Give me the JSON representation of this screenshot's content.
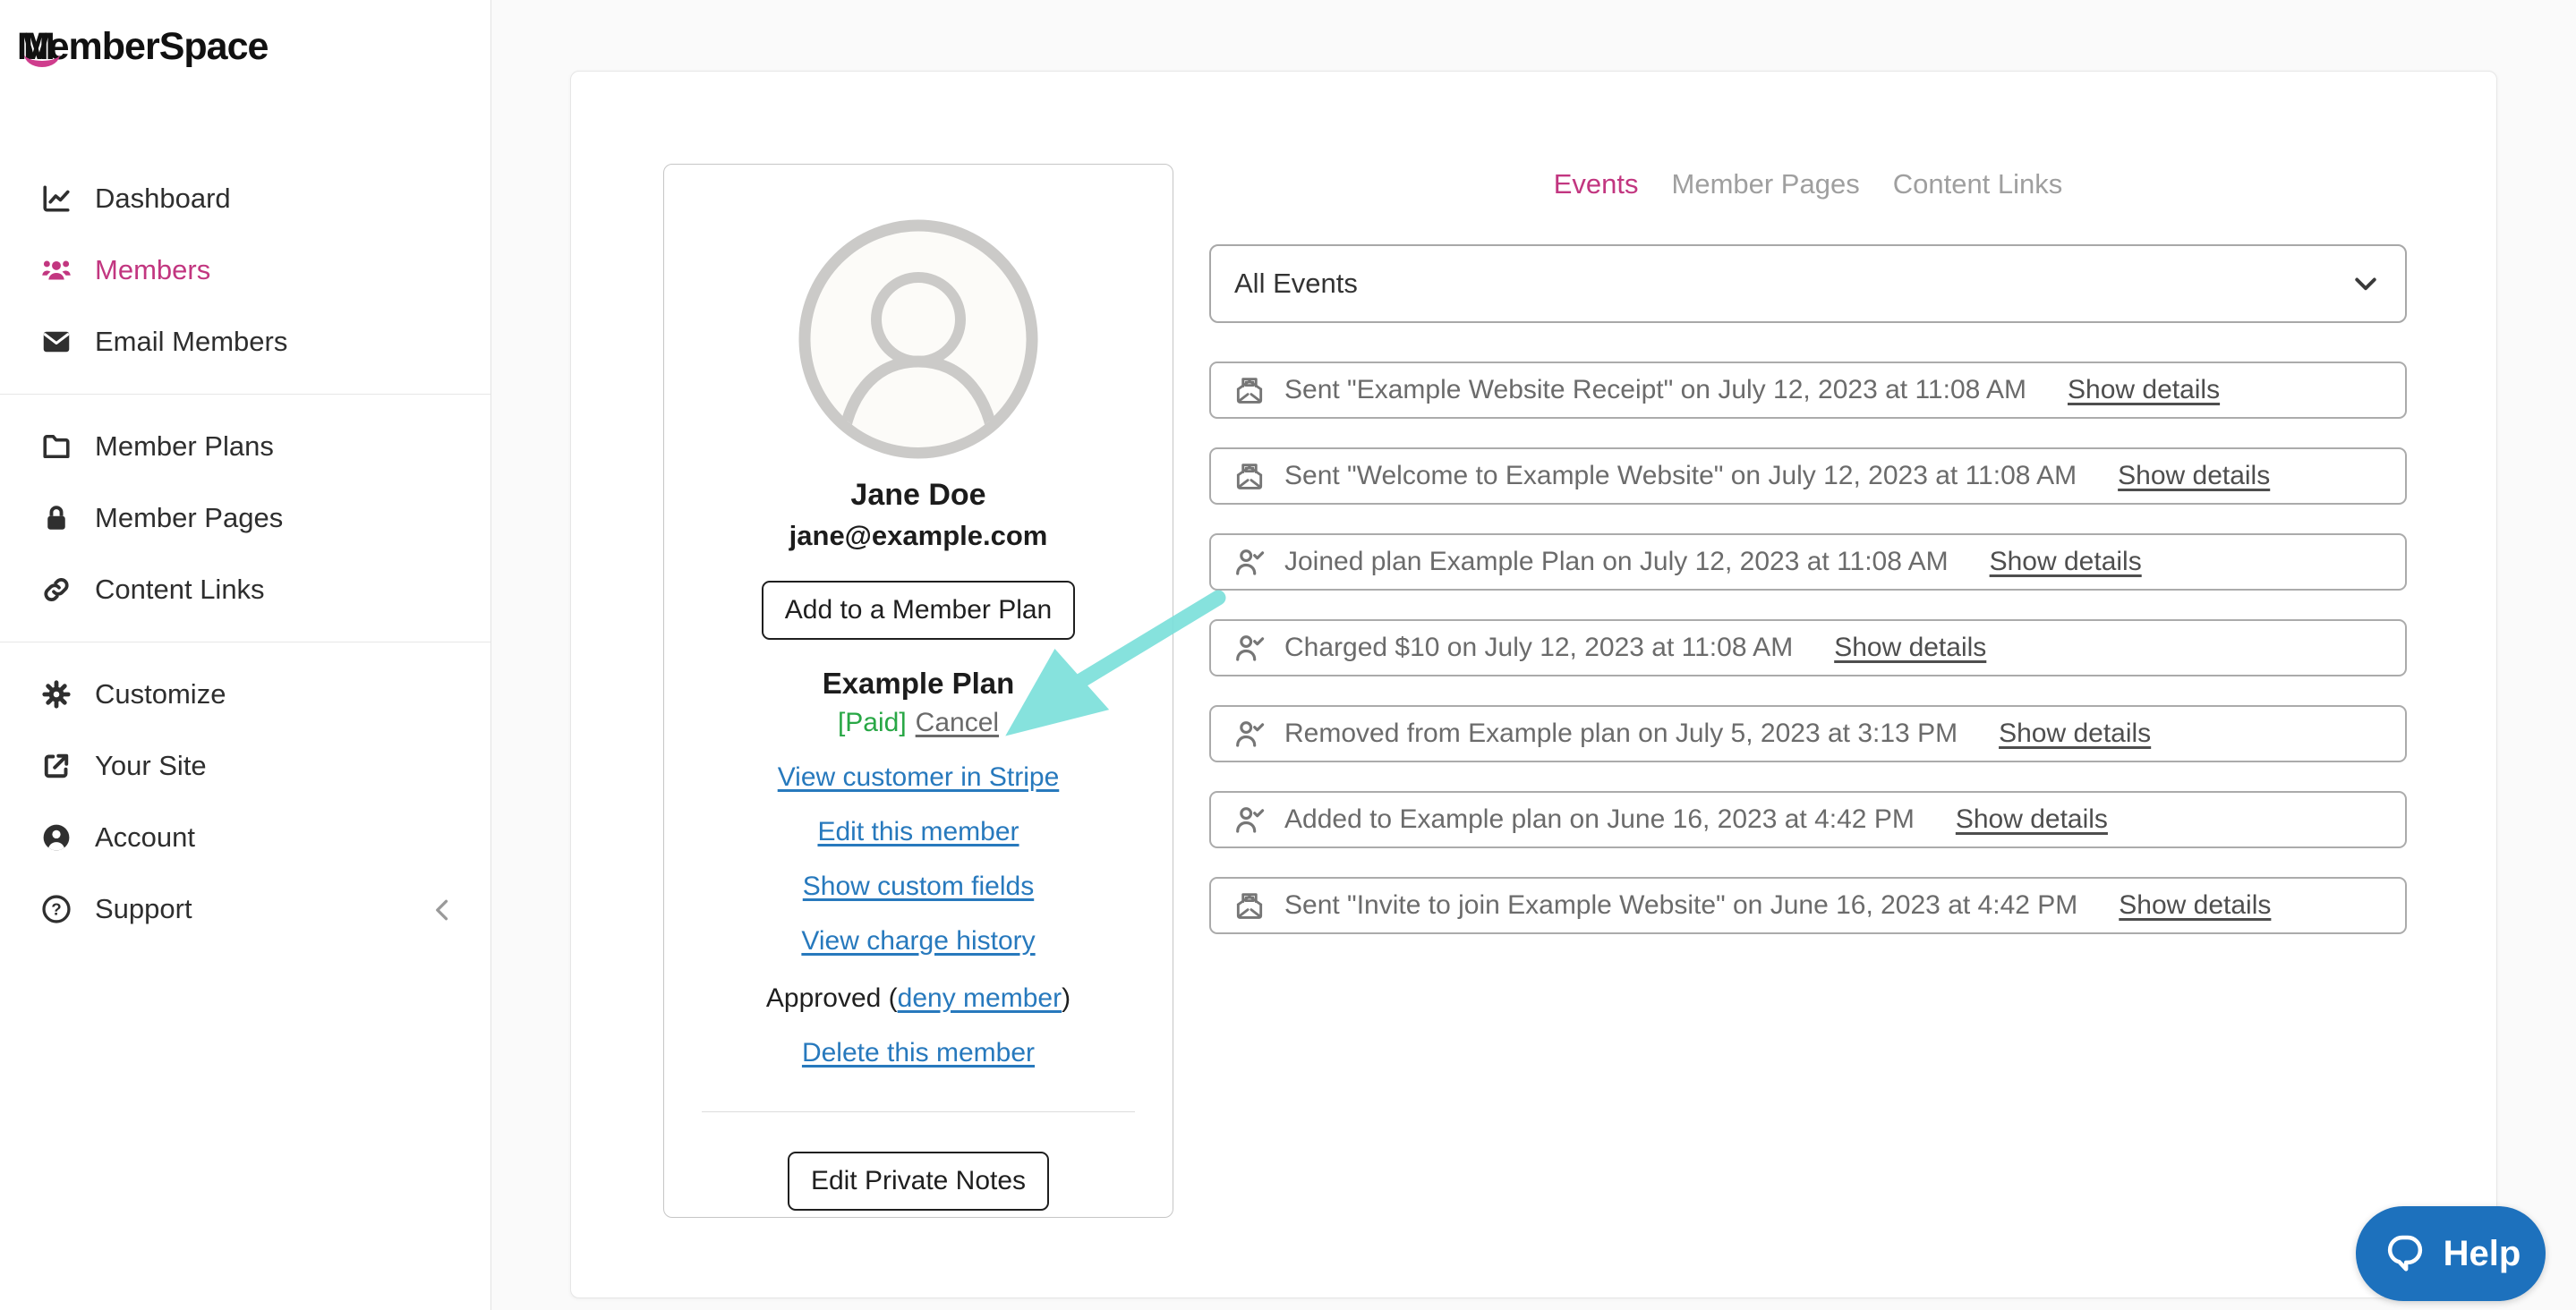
{
  "brand": {
    "name": "MemberSpace"
  },
  "sidebar": {
    "items": [
      {
        "label": "Dashboard",
        "icon": "chart-line-icon",
        "active": false
      },
      {
        "label": "Members",
        "icon": "users-icon",
        "active": true
      },
      {
        "label": "Email Members",
        "icon": "envelope-icon",
        "active": false
      },
      {
        "label": "Member Plans",
        "icon": "folder-icon",
        "active": false
      },
      {
        "label": "Member Pages",
        "icon": "lock-icon",
        "active": false
      },
      {
        "label": "Content Links",
        "icon": "link-icon",
        "active": false
      },
      {
        "label": "Customize",
        "icon": "gear-icon",
        "active": false
      },
      {
        "label": "Your Site",
        "icon": "external-link-icon",
        "active": false
      },
      {
        "label": "Account",
        "icon": "user-circle-icon",
        "active": false
      },
      {
        "label": "Support",
        "icon": "question-circle-icon",
        "active": false
      }
    ],
    "collapse_icon": "chevron-left-icon"
  },
  "member": {
    "name": "Jane Doe",
    "email": "jane@example.com",
    "add_plan_button": "Add to a Member Plan",
    "plan_name": "Example Plan",
    "plan_status": "[Paid]",
    "cancel_link": "Cancel",
    "links": {
      "stripe": "View customer in Stripe",
      "edit": "Edit this member",
      "custom_fields": "Show custom fields",
      "charge_history": "View charge history",
      "delete": "Delete this member"
    },
    "approved_prefix": "Approved (",
    "deny_link": "deny member",
    "approved_suffix": ")",
    "notes_button": "Edit Private Notes"
  },
  "tabs": [
    {
      "label": "Events",
      "active": true
    },
    {
      "label": "Member Pages",
      "active": false
    },
    {
      "label": "Content Links",
      "active": false
    }
  ],
  "filter": {
    "value": "All Events",
    "icon": "chevron-down-icon"
  },
  "events": [
    {
      "icon": "envelope-open-text-icon",
      "text": "Sent \"Example Website Receipt\" on July 12, 2023 at 11:08 AM",
      "link": "Show details"
    },
    {
      "icon": "envelope-open-text-icon",
      "text": "Sent \"Welcome to Example Website\" on July 12, 2023 at 11:08 AM",
      "link": "Show details"
    },
    {
      "icon": "user-check-icon",
      "text": "Joined plan Example Plan on July 12, 2023 at 11:08 AM",
      "link": "Show details"
    },
    {
      "icon": "user-check-icon",
      "text": "Charged $10 on July 12, 2023 at 11:08 AM",
      "link": "Show details"
    },
    {
      "icon": "user-check-icon",
      "text": "Removed from Example plan on July 5, 2023 at 3:13 PM",
      "link": "Show details"
    },
    {
      "icon": "user-check-icon",
      "text": "Added to Example plan on June 16, 2023 at 4:42 PM",
      "link": "Show details"
    },
    {
      "icon": "envelope-open-text-icon",
      "text": "Sent \"Invite to join Example Website\" on June 16, 2023 at 4:42 PM",
      "link": "Show details"
    }
  ],
  "help": {
    "label": "Help",
    "icon": "chat-bubble-icon"
  },
  "colors": {
    "accent_pink": "#c23680",
    "link_blue": "#2779bd",
    "paid_green": "#28a745",
    "arrow_teal": "#7ce0db",
    "help_blue": "#1d71bd"
  }
}
